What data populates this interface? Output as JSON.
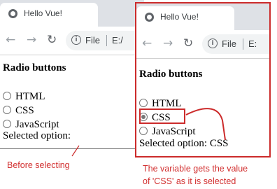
{
  "browser": {
    "tab_title": "Hello Vue!",
    "omnibox_scheme": "File",
    "omnibox_path_left": "E:/",
    "omnibox_path_right": "E:"
  },
  "page": {
    "heading": "Radio buttons",
    "options": [
      "HTML",
      "CSS",
      "JavaScript"
    ],
    "selected_label": "Selected option:",
    "selected_value": "CSS"
  },
  "annotations": {
    "before": "Before selecting",
    "after_line1": "The variable gets the value",
    "after_line2": "of 'CSS' as it is selected"
  },
  "colors": {
    "annotation": "#cc2b2b"
  }
}
